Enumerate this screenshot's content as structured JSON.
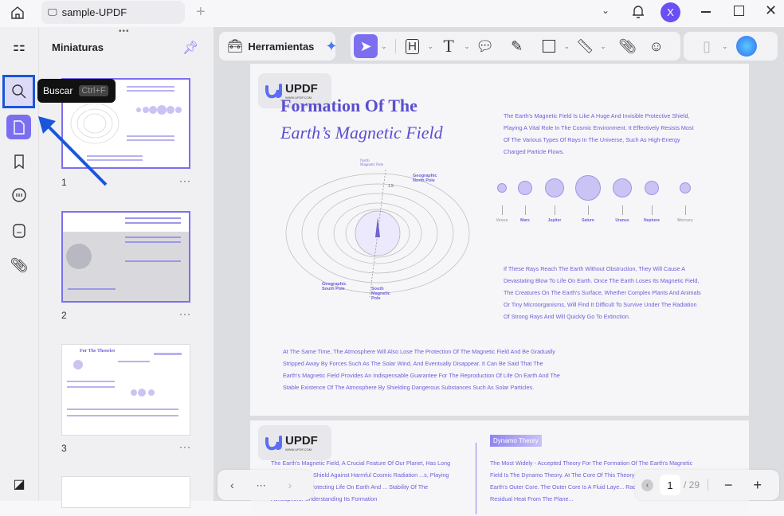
{
  "window": {
    "tab_title": "sample-UPDF",
    "avatar_letter": "X"
  },
  "sidebar": {
    "panel_title": "Miniaturas",
    "tooltip_label": "Buscar",
    "tooltip_shortcut": "Ctrl+F",
    "thumbnails": [
      {
        "label": "1"
      },
      {
        "label": "2"
      },
      {
        "label": "3"
      }
    ],
    "more": "···",
    "thumb3_title": "For The Theories"
  },
  "toolbar": {
    "tools_label": "Herramientas"
  },
  "page1": {
    "logo": "UPDF",
    "logo_url": "WWW.UPDF.COM",
    "title1": "Formation Of The",
    "title2": "Earth’s Magnetic Field",
    "para1": "The Earth's Magnetic Field Is Like A Huge And Invisible Protective Shield, Playing A Vital Role In The Cosmic Environment. It Effectively Resists Most Of The Various Types Of Rays In The Universe, Such As High-Energy Charged Particle Flows.",
    "para2": "If These Rays Reach The Earth Without Obstruction, They Will Cause A Devastating Blow To Life On Earth. Once The Earth Loses Its Magnetic Field, The Creatures On The Earth's Surface, Whether Complex Plants And Animals Or Tiny Microorganisms, Will Find It Difficult To Survive Under The Radiation Of Strong Rays And Will Quickly Go To Extinction.",
    "para3": "At The Same Time, The Atmosphere Will Also Lose The Protection Of The Magnetic Field And Be Gradually Stripped Away By Forces Such As The Solar Wind, And Eventually Disappear. It Can Be Said That The Earth's Magnetic Field Provides An Indispensable Guarantee For The Reproduction Of Life On Earth And The Stable Existence Of The Atmosphere By Shielding Dangerous Substances Such As Solar Particles.",
    "labels": {
      "north_mag": "North Magnetic Pole",
      "geo_north": "Geographic North Pole",
      "geo_south": "Geographic South Pole",
      "south_mag": "South Magnetic Pole",
      "angle": "1.5"
    },
    "planets": [
      "Venus",
      "Mars",
      "Jupiter",
      "Saturn",
      "Uranus",
      "Neptune",
      "Mercury"
    ]
  },
  "page2": {
    "para1": "The Earth's Magnetic Field, A Crucial Feature Of Our Planet, Has Long ...ts. It Acts As A Shield Against Harmful Cosmic Radiation ...s, Playing A Vital Role In Protecting Life On Earth And ... Stability Of The Atmosphere. Understanding Its Formation",
    "badge": "Dynamo Theory",
    "para2": "The Most Widely - Accepted Theory For The Formation Of The Earth's Magnetic Field Is The Dynamo Theory. At The Core Of This Theory Is The M... In The Earth's Outer Core. The Outer Core Is A Fluid Laye... Radioactive Elements And Residual Heat From The Plane..."
  },
  "nav": {
    "more": "···",
    "current_page": "1",
    "total": "/ 29"
  },
  "colors": {
    "accent": "#7b6ff0",
    "text": "#6b5fd6",
    "highlight": "#1a56db"
  }
}
